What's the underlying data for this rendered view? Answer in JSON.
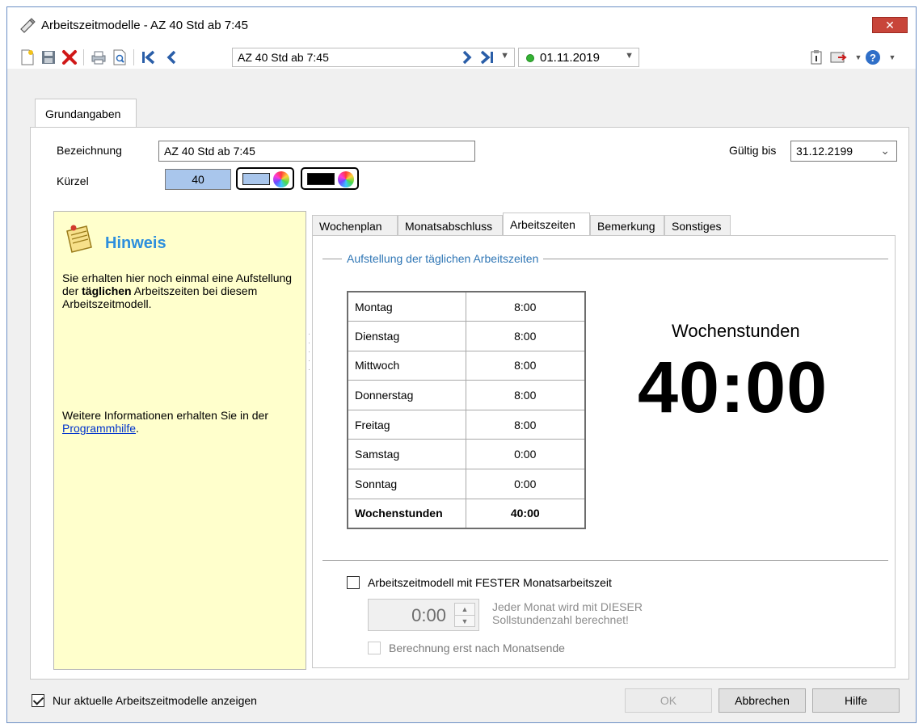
{
  "window": {
    "title": "Arbeitszeitmodelle - AZ 40 Std ab 7:45",
    "close_label": "✕"
  },
  "toolbar": {
    "record_selector_value": "AZ 40 Std ab 7:45",
    "date_selector_value": "01.11.2019",
    "date_status_color": "#34b234"
  },
  "tabs_main": {
    "grundangaben_label": "Grundangaben"
  },
  "form": {
    "bezeichnung_label": "Bezeichnung",
    "bezeichnung_value": "AZ 40 Std ab 7:45",
    "kuerzel_label": "Kürzel",
    "kuerzel_value": "40",
    "kuerzel_bg_color": "#a9c6ec",
    "gueltig_bis_label": "Gültig bis",
    "gueltig_bis_value": "31.12.2199"
  },
  "hint": {
    "title": "Hinweis",
    "text_part1": "Sie erhalten hier noch einmal eine Aufstellung der ",
    "text_bold": "täglichen",
    "text_part2": " Arbeitszeiten bei diesem Arbeitszeitmodell.",
    "more_text": "Weitere Informationen erhalten Sie in der ",
    "link_text": "Programmhilfe",
    "more_suffix": "."
  },
  "sub_tabs": {
    "wochenplan": "Wochenplan",
    "monatsabschluss": "Monatsabschluss",
    "arbeitszeiten": "Arbeitszeiten",
    "bemerkung": "Bemerkung",
    "sonstiges": "Sonstiges"
  },
  "arbeitszeiten": {
    "group_title": "Aufstellung der täglichen Arbeitszeiten",
    "rows": [
      {
        "day": "Montag",
        "hours": "8:00"
      },
      {
        "day": "Dienstag",
        "hours": "8:00"
      },
      {
        "day": "Mittwoch",
        "hours": "8:00"
      },
      {
        "day": "Donnerstag",
        "hours": "8:00"
      },
      {
        "day": "Freitag",
        "hours": "8:00"
      },
      {
        "day": "Samstag",
        "hours": "0:00"
      },
      {
        "day": "Sonntag",
        "hours": "0:00"
      }
    ],
    "total_label": "Wochenstunden",
    "total_value": "40:00",
    "big_label": "Wochenstunden",
    "big_value": "40:00",
    "fixed_month_label": "Arbeitszeitmodell mit FESTER Monatsarbeitszeit",
    "month_hours_value": "0:00",
    "month_note_line1": "Jeder Monat wird mit DIESER",
    "month_note_line2": "Sollstundenzahl berechnet!",
    "after_month_label": "Berechnung erst nach Monatsende"
  },
  "footer": {
    "only_current_label": "Nur aktuelle Arbeitszeitmodelle anzeigen",
    "ok_label": "OK",
    "cancel_label": "Abbrechen",
    "help_label": "Hilfe"
  }
}
